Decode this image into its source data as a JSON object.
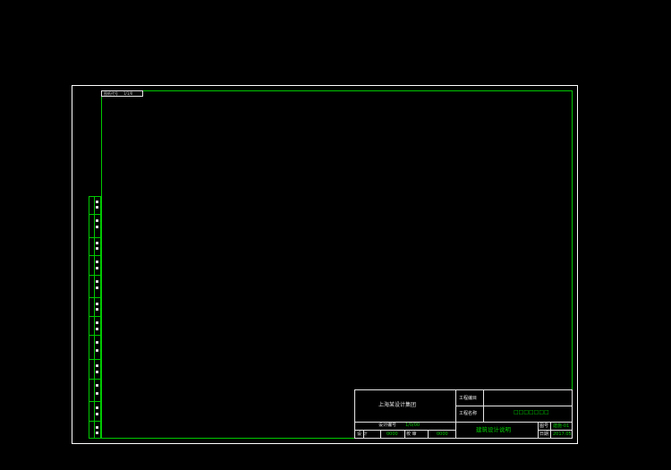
{
  "colors": {
    "background": "#000000",
    "sheet_border": "#ffffff",
    "frame_green": "#00c800",
    "text_white": "#e6e6e6",
    "text_green": "#00d000"
  },
  "drawing_code": {
    "label": "图纸代号",
    "value": "1/1/0"
  },
  "title_block": {
    "company": "上海某设计集团",
    "project_subitem_label": "工程编目",
    "project_name_label": "工程名称",
    "project_name_value": "□□□□□□□",
    "design_number_label": "设计编号",
    "design_number_value": "1/0/00",
    "designer_label": "设  计",
    "designer_value": "0000",
    "reviewer_label": "校 审",
    "reviewer_value": "0000",
    "drawing_title": "建筑设计说明",
    "drawing_no_label": "图号",
    "drawing_no_value": "建施-01",
    "date_label": "日期",
    "date_value": "2017.05"
  }
}
